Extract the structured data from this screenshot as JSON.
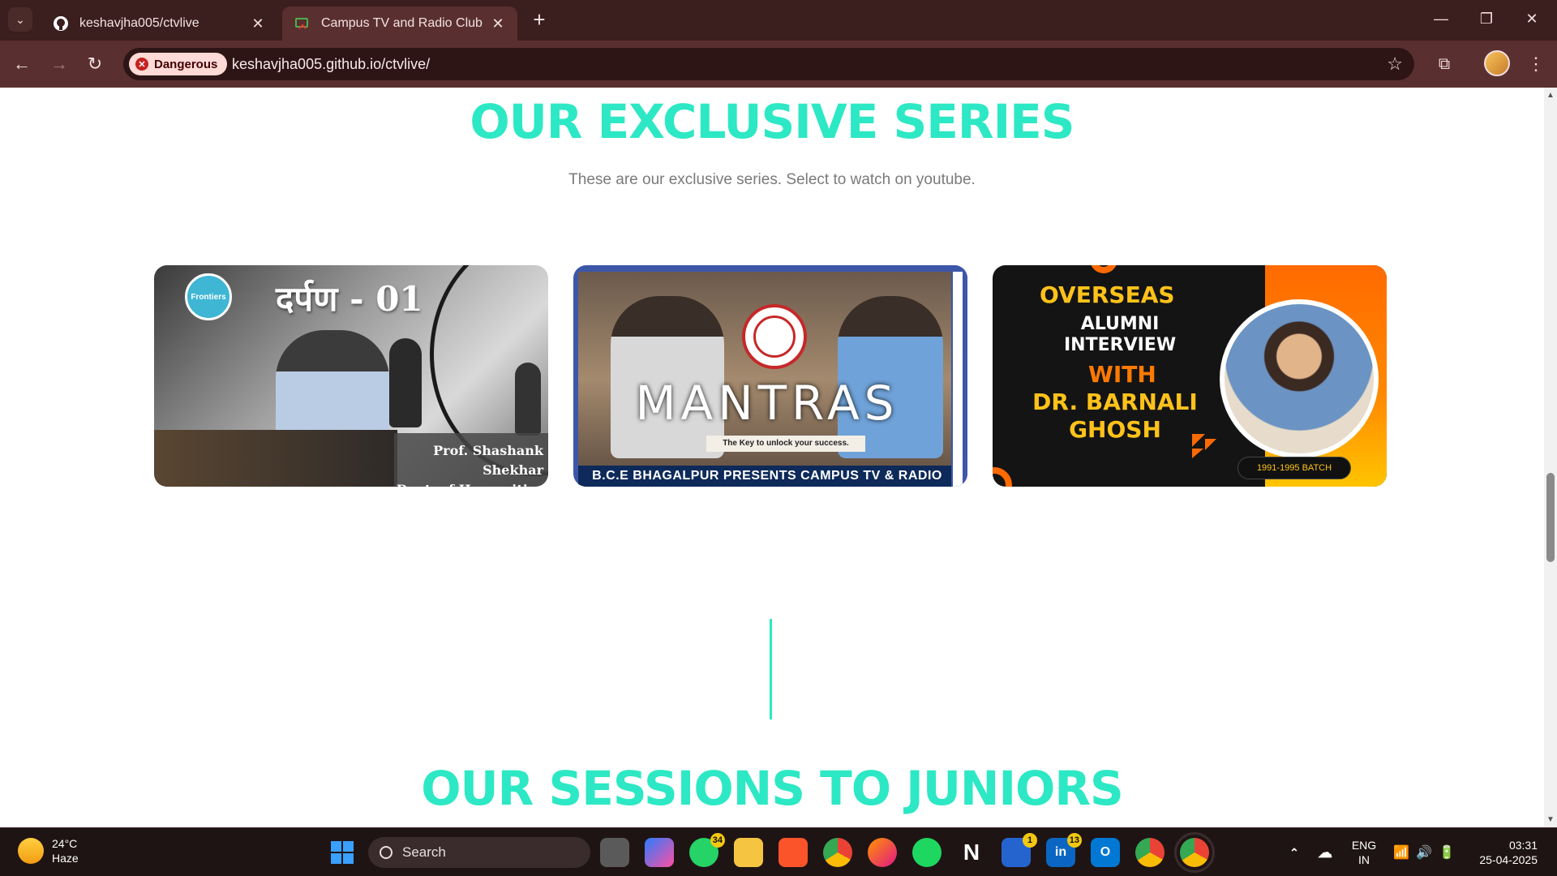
{
  "browser": {
    "tabs": [
      {
        "title": "keshavjha005/ctvlive",
        "icon": "github-icon",
        "active": false
      },
      {
        "title": "Campus TV and Radio Club",
        "icon": "site-favicon",
        "active": true
      }
    ],
    "security_chip": "Dangerous",
    "url": "keshavjha005.github.io/ctvlive/"
  },
  "page": {
    "exclusive_heading": "OUR EXCLUSIVE SERIES",
    "exclusive_subtitle": "These are our exclusive series. Select to watch on youtube.",
    "cards": [
      {
        "title": "दर्पण - 01",
        "caption_line1": "Prof. Shashank Shekhar",
        "caption_line2": "Dept. of Humanities",
        "badge": "Frontiers"
      },
      {
        "title": "MANTRAS",
        "tagline": "The Key to unlock your success.",
        "footer": "B.C.E BHAGALPUR PRESENTS CAMPUS TV & RADIO"
      },
      {
        "line1": "OVERSEAS",
        "line2": "ALUMNI",
        "line3": "INTERVIEW",
        "line4": "WITH",
        "line5": "DR. BARNALI",
        "line6": "GHOSH",
        "batch": "1991-1995 BATCH"
      }
    ],
    "sessions_heading": "OUR SESSIONS TO JUNIORS"
  },
  "taskbar": {
    "weather_temp": "24°C",
    "weather_desc": "Haze",
    "search_placeholder": "Search",
    "whatsapp_badge": "34",
    "todo_badge": "1",
    "linkedin_badge": "13",
    "lang_line1": "ENG",
    "lang_line2": "IN",
    "time": "03:31",
    "date": "25-04-2025"
  },
  "colors": {
    "accent": "#2de8c4",
    "chrome_dark": "#3b1e1e",
    "chrome_toolbar": "#5a2f2f"
  }
}
